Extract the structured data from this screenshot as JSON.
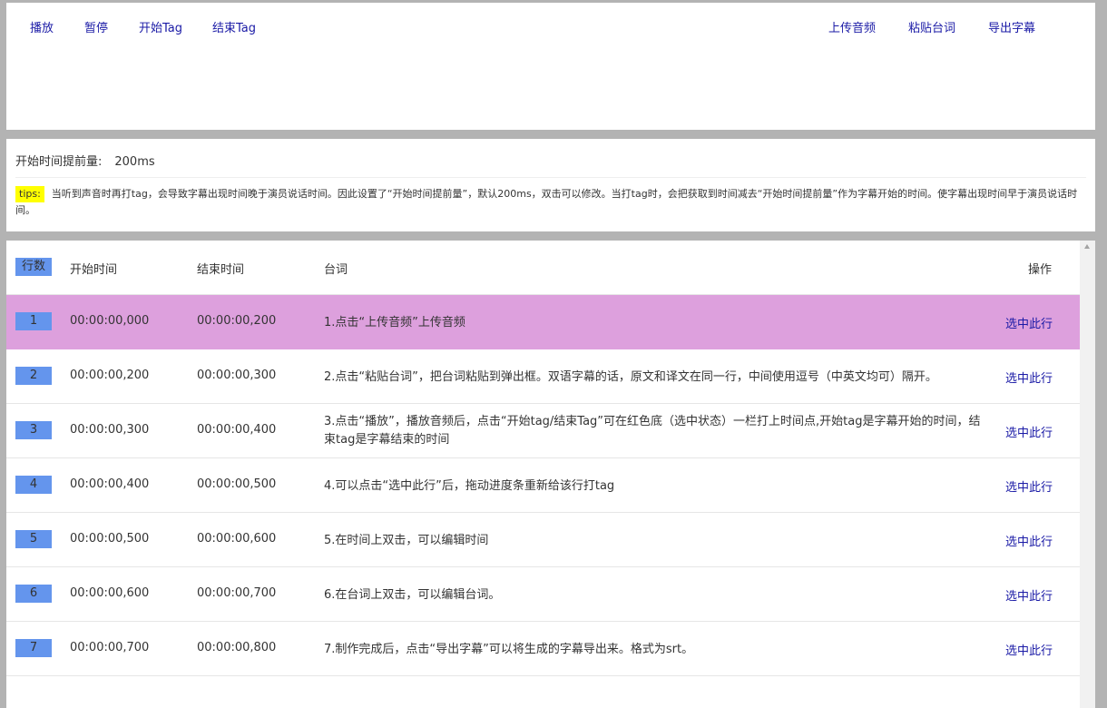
{
  "toolbar": {
    "play": "播放",
    "pause": "暂停",
    "start_tag": "开始Tag",
    "end_tag": "结束Tag",
    "upload_audio": "上传音频",
    "paste_lines": "粘贴台词",
    "export_subtitle": "导出字幕"
  },
  "settings": {
    "offset_label": "开始时间提前量:",
    "offset_value": "200ms",
    "tips_badge": "tips:",
    "tips_text": "当听到声音时再打tag，会导致字幕出现时间晚于演员说话时间。因此设置了“开始时间提前量”，默认200ms，双击可以修改。当打tag时，会把获取到时间减去“开始时间提前量”作为字幕开始的时间。使字幕出现时间早于演员说话时间。"
  },
  "table": {
    "headers": {
      "row_num": "行数",
      "start": "开始时间",
      "end": "结束时间",
      "text": "台词",
      "action": "操作"
    },
    "rows": [
      {
        "num": "1",
        "start": "00:00:00,000",
        "end": "00:00:00,200",
        "text": "1.点击“上传音频”上传音频",
        "action": "选中此行",
        "selected": true
      },
      {
        "num": "2",
        "start": "00:00:00,200",
        "end": "00:00:00,300",
        "text": "2.点击“粘贴台词”，把台词粘贴到弹出框。双语字幕的话，原文和译文在同一行，中间使用逗号（中英文均可）隔开。",
        "action": "选中此行",
        "selected": false
      },
      {
        "num": "3",
        "start": "00:00:00,300",
        "end": "00:00:00,400",
        "text": "3.点击“播放”，播放音频后，点击“开始tag/结束Tag”可在红色底（选中状态）一栏打上时间点,开始tag是字幕开始的时间，结束tag是字幕结束的时间",
        "action": "选中此行",
        "selected": false
      },
      {
        "num": "4",
        "start": "00:00:00,400",
        "end": "00:00:00,500",
        "text": "4.可以点击“选中此行”后，拖动进度条重新给该行打tag",
        "action": "选中此行",
        "selected": false
      },
      {
        "num": "5",
        "start": "00:00:00,500",
        "end": "00:00:00,600",
        "text": "5.在时间上双击，可以编辑时间",
        "action": "选中此行",
        "selected": false
      },
      {
        "num": "6",
        "start": "00:00:00,600",
        "end": "00:00:00,700",
        "text": "6.在台词上双击，可以编辑台词。",
        "action": "选中此行",
        "selected": false
      },
      {
        "num": "7",
        "start": "00:00:00,700",
        "end": "00:00:00,800",
        "text": "7.制作完成后，点击“导出字幕”可以将生成的字幕导出来。格式为srt。",
        "action": "选中此行",
        "selected": false
      }
    ]
  },
  "colors": {
    "selected_row": "#dda0dd",
    "row_badge": "#6495ed",
    "link": "#1a1aa6",
    "tips_badge": "#ffff00"
  }
}
